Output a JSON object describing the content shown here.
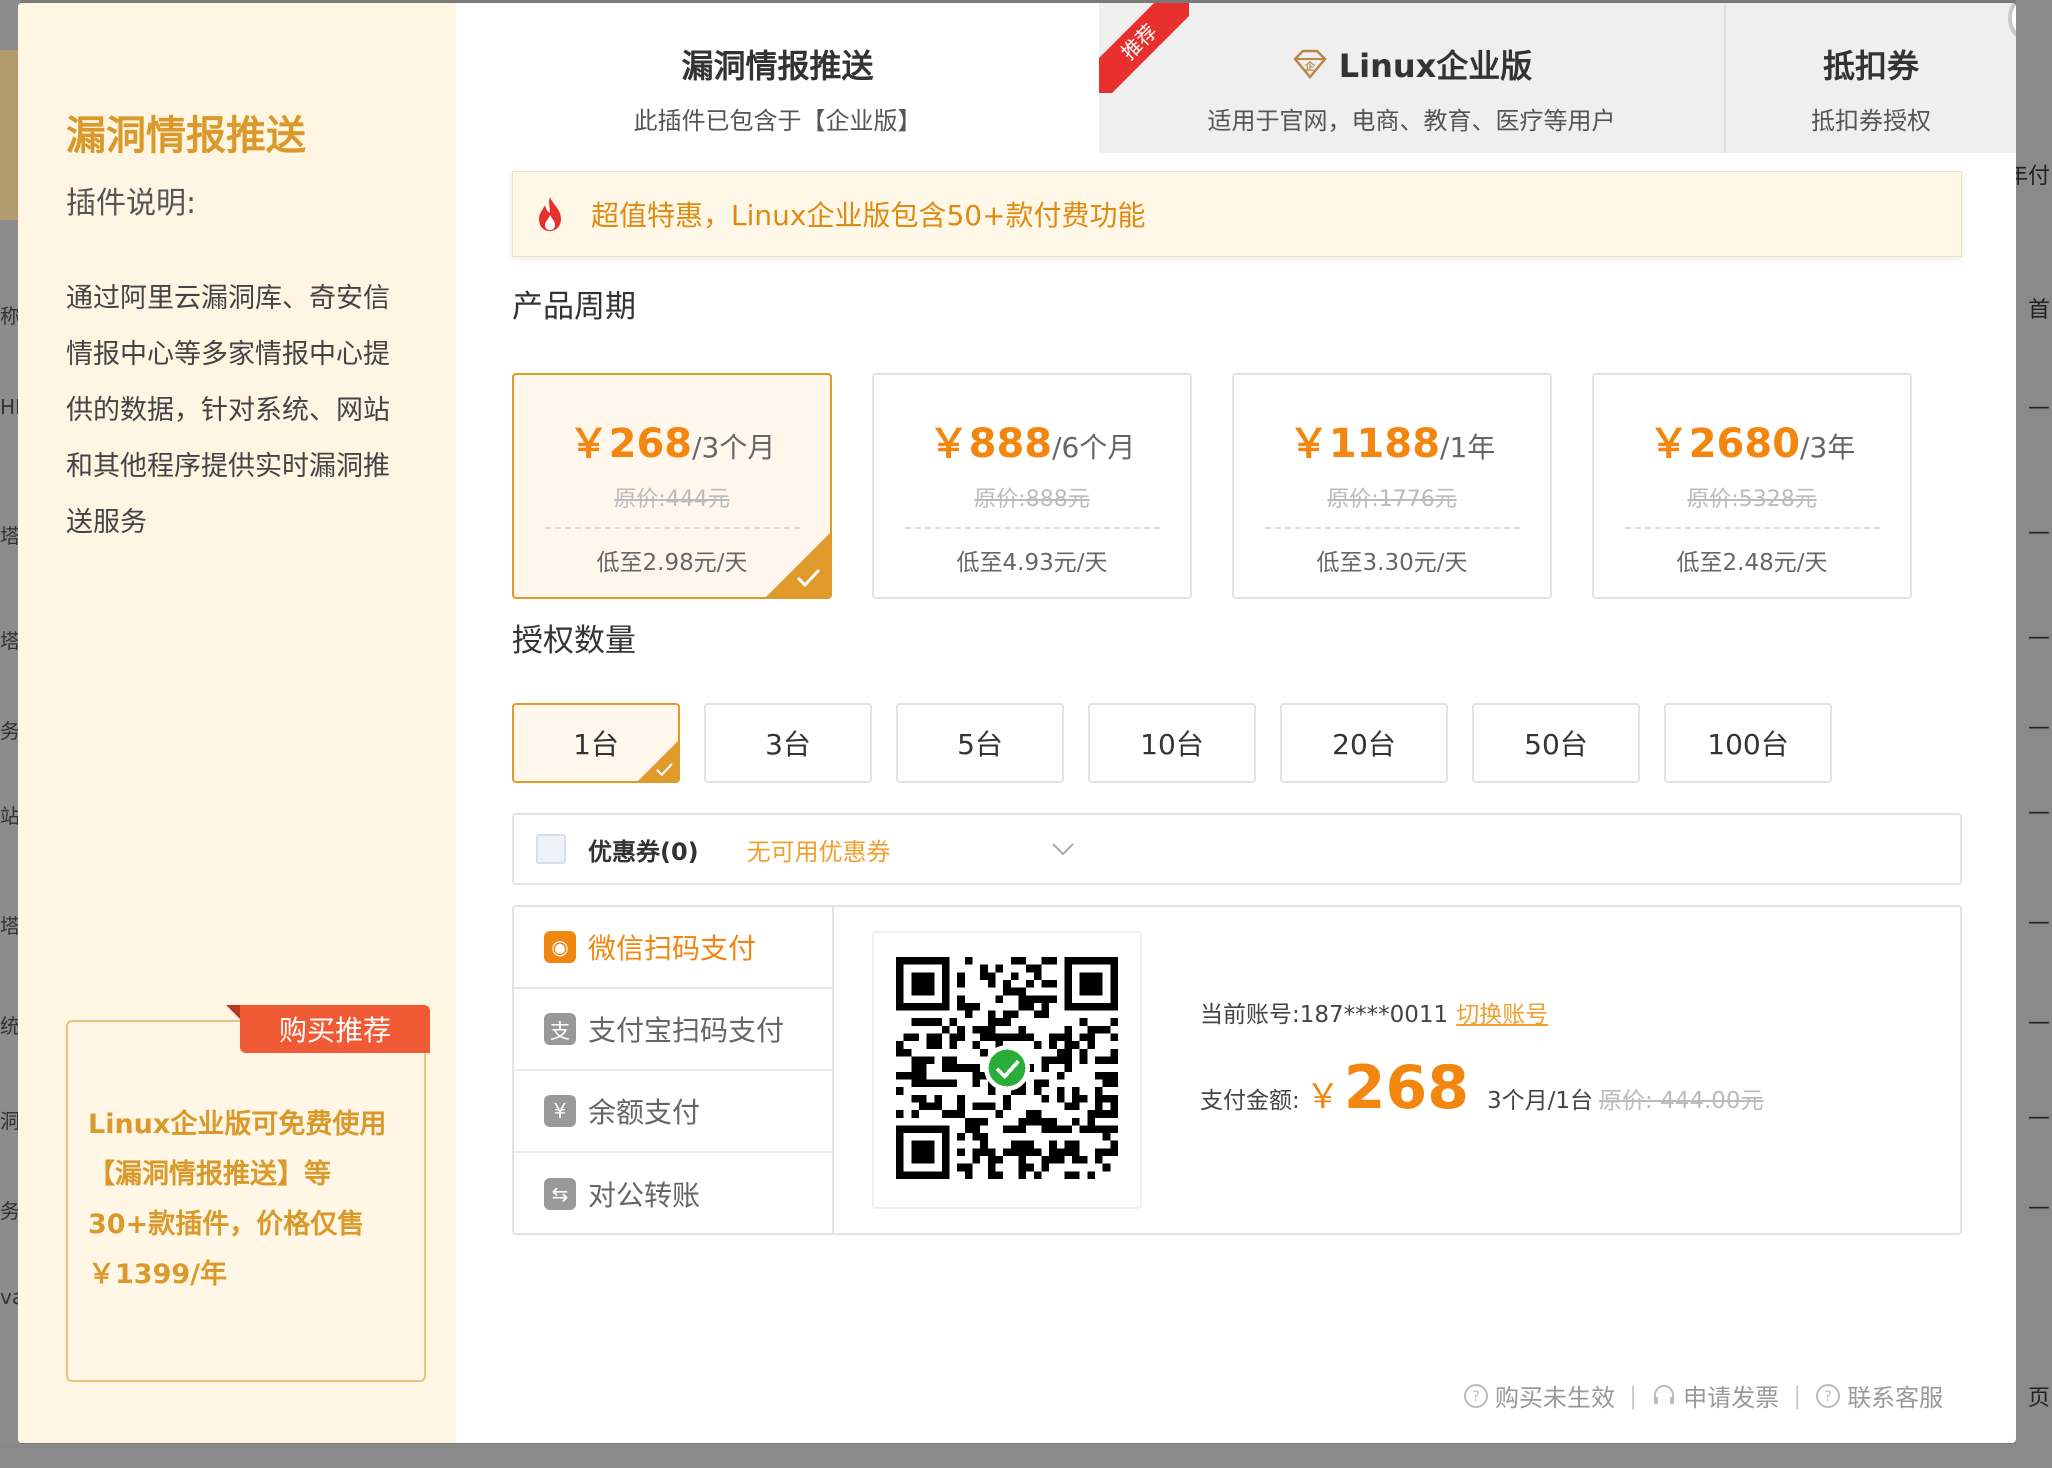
{
  "background": {
    "left_fragments": [
      "称",
      "HF",
      "塔",
      "塔",
      "务",
      "站",
      "塔",
      "统",
      "洞",
      "务",
      "va"
    ],
    "right_fragments": [
      "年付",
      "首",
      "—",
      "—",
      "—",
      "—",
      "—",
      "—",
      "—",
      "—",
      "—",
      "页"
    ]
  },
  "left_panel": {
    "title": "漏洞情报推送",
    "subtitle": "插件说明:",
    "description": "通过阿里云漏洞库、奇安信情报中心等多家情报中心提供的数据，针对系统、网站和其他程序提供实时漏洞推送服务",
    "recommend_tag": "购买推荐",
    "recommend_text": "Linux企业版可免费使用【漏洞情报推送】等30+款插件，价格仅售￥1399/年"
  },
  "tabs": [
    {
      "title": "漏洞情报推送",
      "subtitle": "此插件已包含于【企业版】"
    },
    {
      "title": "Linux企业版",
      "subtitle": "适用于官网，电商、教育、医疗等用户",
      "badge": "推荐"
    },
    {
      "title": "抵扣券",
      "subtitle": "抵扣券授权"
    }
  ],
  "promo": {
    "text": "超值特惠，Linux企业版包含50+款付费功能"
  },
  "period": {
    "title": "产品周期",
    "selected_index": 0,
    "options": [
      {
        "currency": "￥",
        "price": "268",
        "unit": "/3个月",
        "original": "原价:444元",
        "daily": "低至2.98元/天"
      },
      {
        "currency": "￥",
        "price": "888",
        "unit": "/6个月",
        "original": "原价:888元",
        "daily": "低至4.93元/天"
      },
      {
        "currency": "￥",
        "price": "1188",
        "unit": "/1年",
        "original": "原价:1776元",
        "daily": "低至3.30元/天"
      },
      {
        "currency": "￥",
        "price": "2680",
        "unit": "/3年",
        "original": "原价:5328元",
        "daily": "低至2.48元/天"
      }
    ]
  },
  "quantity": {
    "title": "授权数量",
    "selected_index": 0,
    "options": [
      "1台",
      "3台",
      "5台",
      "10台",
      "20台",
      "50台",
      "100台"
    ]
  },
  "coupon": {
    "label": "优惠券(0)",
    "value": "无可用优惠券"
  },
  "payment": {
    "methods": [
      {
        "label": "微信扫码支付",
        "icon": "wechat-icon",
        "glyph": "◉",
        "active": true
      },
      {
        "label": "支付宝扫码支付",
        "icon": "alipay-icon",
        "glyph": "支",
        "active": false
      },
      {
        "label": "余额支付",
        "icon": "balance-icon",
        "glyph": "¥",
        "active": false
      },
      {
        "label": "对公转账",
        "icon": "transfer-icon",
        "glyph": "⇆",
        "active": false
      }
    ],
    "account_label": "当前账号:187****0011",
    "switch_account": "切换账号",
    "amount_label": "支付金额:",
    "amount_currency": "￥",
    "amount_value": "268",
    "amount_period": "3个月/1台",
    "amount_original": "原价: 444.00元"
  },
  "footer": {
    "links": [
      {
        "label": "购买未生效",
        "icon": "question-circle-icon"
      },
      {
        "label": "申请发票",
        "icon": "headset-icon"
      },
      {
        "label": "联系客服",
        "icon": "question-circle-icon"
      }
    ]
  },
  "colors": {
    "accent": "#f2860f",
    "gold": "#d99a2b",
    "badge_red": "#e8312f"
  }
}
